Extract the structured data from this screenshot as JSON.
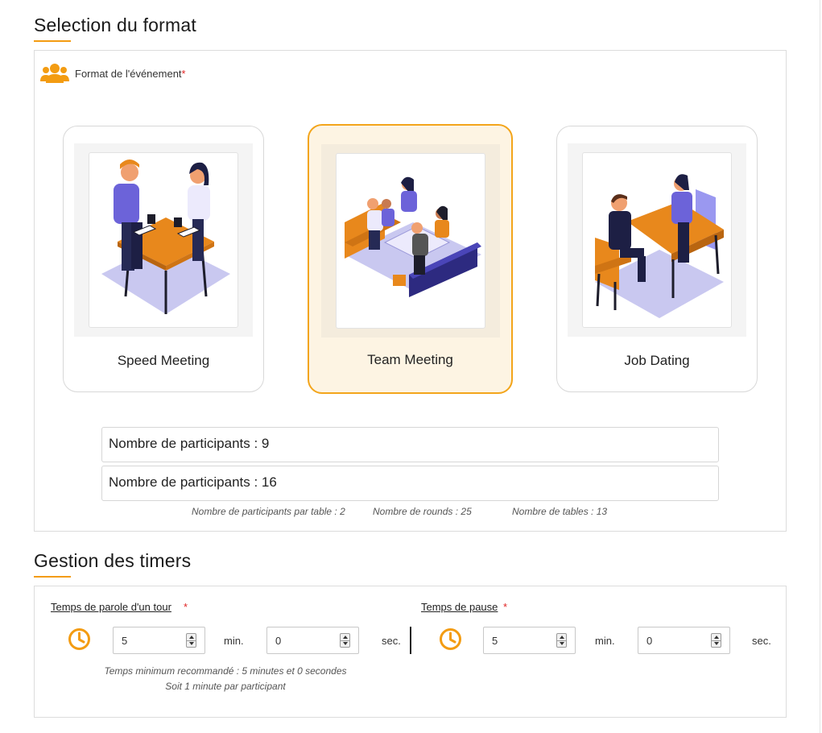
{
  "format_section": {
    "title": "Selection du format",
    "field_label": "Format de l'événement",
    "required_mark": "*",
    "icon": "users-group-icon",
    "cards": [
      {
        "label": "Speed Meeting",
        "selected": false
      },
      {
        "label": "Team Meeting",
        "selected": true
      },
      {
        "label": "Job Dating",
        "selected": false
      }
    ],
    "participant_options": [
      "Nombre de participants : 9",
      "Nombre de participants : 16"
    ],
    "stats": {
      "per_table": "Nombre de participants par table : 2",
      "rounds": "Nombre de rounds : 25",
      "tables": "Nombre de tables : 13"
    }
  },
  "timers_section": {
    "title": "Gestion des timers",
    "talk": {
      "label": "Temps de parole d'un tour",
      "required_mark": "*",
      "minutes": "5",
      "seconds": "0",
      "min_unit": "min.",
      "sec_unit": "sec."
    },
    "pause": {
      "label": "Temps de pause",
      "required_mark": "*",
      "minutes": "5",
      "seconds": "0",
      "min_unit": "min.",
      "sec_unit": "sec."
    },
    "hint_line1": "Temps minimum recommandé : 5 minutes et 0 secondes",
    "hint_line2": "Soit 1 minute par participant"
  },
  "colors": {
    "accent": "#f39c12",
    "selected_border": "#f3a51b",
    "selected_bg": "#fdf4e3",
    "required": "#e02424"
  }
}
